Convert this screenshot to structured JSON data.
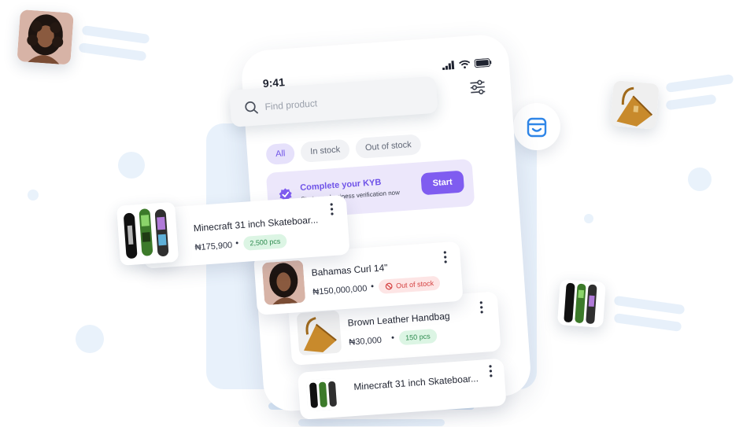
{
  "status_bar": {
    "time": "9:41"
  },
  "search": {
    "placeholder": "Find product"
  },
  "filters": [
    {
      "label": "All",
      "active": true
    },
    {
      "label": "In stock",
      "active": false
    },
    {
      "label": "Out of stock",
      "active": false
    }
  ],
  "kyb_banner": {
    "title": "Complete your KYB",
    "subtitle": "Start your business verification now",
    "button": "Start"
  },
  "products": [
    {
      "name": "Minecraft 31 inch Skateboar...",
      "price": "₦175,900",
      "stock": "2,500 pcs",
      "stock_status": "in"
    },
    {
      "name": "Bahamas Curl 14\"",
      "price": "₦150,000,000",
      "stock": "Out of stock",
      "stock_status": "out"
    },
    {
      "name": "Brown Leather Handbag",
      "price": "₦30,000",
      "stock": "150 pcs",
      "stock_status": "in"
    },
    {
      "name": "Minecraft 31 inch Skateboar..."
    }
  ],
  "colors": {
    "accent": "#7f5cf0",
    "accent_light": "#ece7fb",
    "in_stock_bg": "#dcf5e4",
    "in_stock_text": "#2e8b4f",
    "out_stock_bg": "#fde5e5",
    "out_stock_text": "#d44040",
    "background_panel": "#e8f1fb"
  },
  "icons": [
    "search-icon",
    "filter-sliders-icon",
    "signal-icon",
    "wifi-icon",
    "battery-icon",
    "verified-badge-icon",
    "kebab-menu-icon",
    "out-of-stock-icon",
    "store-icon"
  ]
}
